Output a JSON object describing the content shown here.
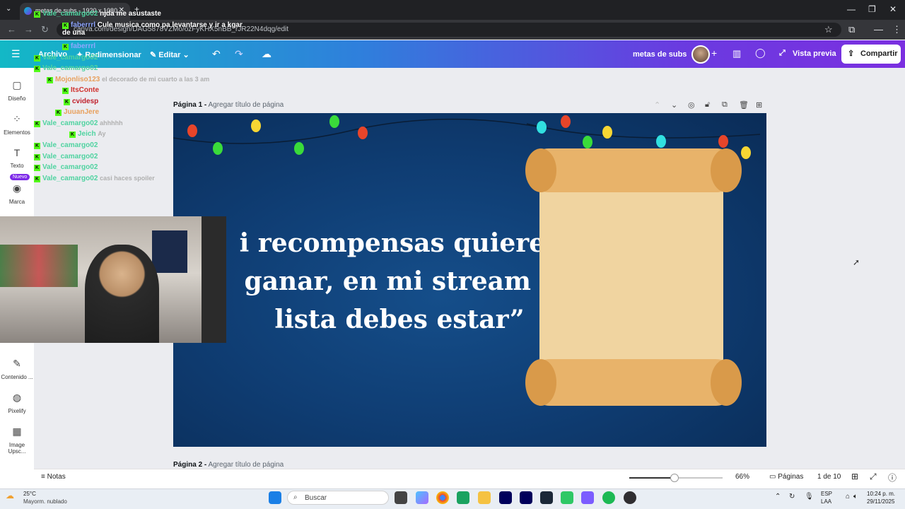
{
  "browser": {
    "tab_title": "metas de subs - 1920 x 1080",
    "url": "canva.com/design/DAG5878VZMo/ozFyKHX5nBB_rJR22N4dqg/edit"
  },
  "header": {
    "menu_file": "Archivo",
    "menu_resize": "Redimensionar",
    "menu_edit": "Editar",
    "doc_title": "metas de subs",
    "preview": "Vista previa",
    "share": "Compartir"
  },
  "sidebar": {
    "items": [
      {
        "label": "Diseño"
      },
      {
        "label": "Elementos"
      },
      {
        "label": "Texto"
      },
      {
        "label": "Marca"
      },
      {
        "label": "Contenido ..."
      },
      {
        "label": "Pixelify"
      },
      {
        "label": "Image Upsc..."
      }
    ],
    "new_badge": "Nuevo"
  },
  "pages": {
    "page1_label": "Página 1 -",
    "page1_sub": "Agregar título de página",
    "page2_label": "Página 2 -",
    "page2_sub": "Agregar título de página"
  },
  "slide": {
    "line1": "i recompensas  quieres",
    "line2": "ganar, en mi stream y",
    "line3": "lista debes estar”"
  },
  "chat": [
    {
      "user": "Vale_camargo02",
      "msg": "njda me asustaste",
      "user_color": "#4fd3a0",
      "msg_color": "#ffffff"
    },
    {
      "user": "faberrrl",
      "msg": "Cule musica como pa levantarse y ir a kgar de una",
      "user_color": "#8fa6ff",
      "msg_color": "#ffffff"
    },
    {
      "user": "faberrrl",
      "msg": "",
      "user_color": "#8fa6ff",
      "msg_color": "#ffffff"
    },
    {
      "user": "Vale_camargo02",
      "msg": "",
      "user_color": "#4fd3a0",
      "msg_color": "#ffffff"
    },
    {
      "user": "Vale_camargo02",
      "msg": "",
      "user_color": "#4fd3a0",
      "msg_color": "#ffffff"
    },
    {
      "user": "Mojonliso123",
      "msg": "el decorado de mi cuarto a las 3 am",
      "user_color": "#e8a05c",
      "msg_color": "#b0b0b0"
    },
    {
      "user": "ItsConte",
      "msg": "",
      "user_color": "#d0302c",
      "msg_color": "#ffffff"
    },
    {
      "user": "cvidesp",
      "msg": "",
      "user_color": "#c0202c",
      "msg_color": "#ffffff"
    },
    {
      "user": "JuuanJere",
      "msg": "",
      "user_color": "#e8a05c",
      "msg_color": "#ffffff"
    },
    {
      "user": "Vale_camargo02",
      "msg": "ahhhhh",
      "user_color": "#4fd3a0",
      "msg_color": "#b0b0b0"
    },
    {
      "user": "Jeich",
      "msg": "Ay",
      "user_color": "#4fd3a0",
      "msg_color": "#b0b0b0"
    },
    {
      "user": "Vale_camargo02",
      "msg": "",
      "user_color": "#4fd3a0",
      "msg_color": "#ffffff"
    },
    {
      "user": "Vale_camargo02",
      "msg": "",
      "user_color": "#4fd3a0",
      "msg_color": "#ffffff"
    },
    {
      "user": "Vale_camargo02",
      "msg": "",
      "user_color": "#4fd3a0",
      "msg_color": "#ffffff"
    },
    {
      "user": "Vale_camargo02",
      "msg": "casi haces spoiler",
      "user_color": "#4fd3a0",
      "msg_color": "#b0b0b0"
    }
  ],
  "bottombar": {
    "notes": "Notas",
    "zoom": "66%",
    "pages": "Páginas",
    "page_count": "1 de 10"
  },
  "taskbar": {
    "temp": "25°C",
    "weather": "Mayorm. nublado",
    "search": "Buscar",
    "lang1": "ESP",
    "lang2": "LAA",
    "time": "10:24 p. m.",
    "date": "29/11/2025"
  },
  "colors": {
    "canva_gradient_start": "#13b8c6",
    "canva_gradient_end": "#7b2fe0",
    "slide_bg": "#0f3d73",
    "kick_green": "#53fc18"
  }
}
